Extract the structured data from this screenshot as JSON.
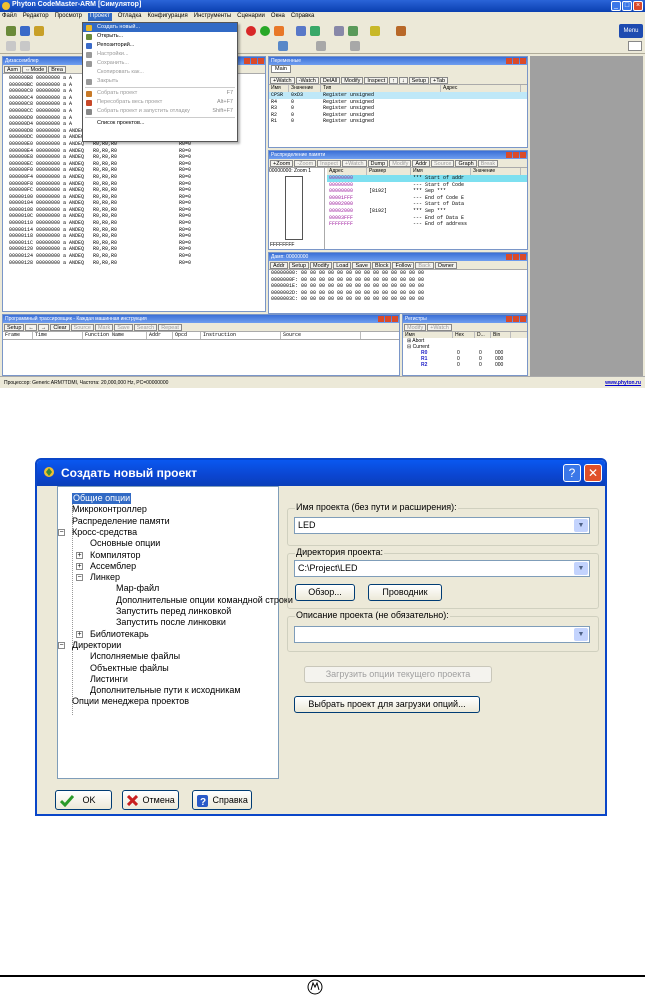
{
  "ide": {
    "title": "Phyton CodeMaster-ARM [Симулятор]",
    "menu": [
      "Файл",
      "Редактор",
      "Просмотр",
      "Проект",
      "Отладка",
      "Конфигурация",
      "Инструменты",
      "Сценарии",
      "Окна",
      "Справка"
    ],
    "menu_selected": "Проект",
    "menu_button": "Menu",
    "project_menu": [
      {
        "label": "Создать новый...",
        "shortcut": "",
        "state": "active",
        "icon_color": "#e8b828"
      },
      {
        "label": "Открыть...",
        "shortcut": "",
        "state": "normal",
        "icon_color": "#6a8a3a"
      },
      {
        "label": "Репозиторий...",
        "shortcut": "",
        "state": "normal",
        "icon_color": "#3a6ac8"
      },
      {
        "label": "Настройки...",
        "shortcut": "",
        "state": "disabled",
        "icon_color": "#999999"
      },
      {
        "label": "Сохранить...",
        "shortcut": "",
        "state": "disabled",
        "icon_color": "#999999"
      },
      {
        "label": "Скопировать как...",
        "shortcut": "",
        "state": "disabled",
        "icon_color": "#ffffff"
      },
      {
        "label": "Закрыть",
        "shortcut": "",
        "state": "disabled",
        "icon_color": "#999999"
      },
      {
        "label": "Собрать проект",
        "shortcut": "F7",
        "state": "disabled",
        "icon_color": "#c87a28"
      },
      {
        "label": "Пересобрать весь проект",
        "shortcut": "Alt+F7",
        "state": "disabled",
        "icon_color": "#c84828"
      },
      {
        "label": "Собрать проект и запустить отладку",
        "shortcut": "Shift+F7",
        "state": "disabled",
        "icon_color": "#888888"
      },
      {
        "label": "Список проектов...",
        "shortcut": "",
        "state": "normal",
        "icon_color": "#ffffff"
      }
    ],
    "disasm": {
      "title": "Дизассемблер",
      "buttons": [
        "Asm",
        "⇔Mode",
        "Brea"
      ],
      "rows": [
        "000000B8 00000000 a A",
        "000000BC 00000000 a A",
        "000000C0 00000000 a A",
        "000000C4 00000000 a A",
        "000000C8 00000000 a A",
        "000000CC 00000000 a A",
        "000000D0 00000000 a A",
        "000000D4 00000000 a A",
        "000000D8 00000000 a ANDEQ   R0,R0,R0",
        "000000DC 00000000 a ANDEQ   R0,R0,R0",
        "000000E0 00000000 a ANDEQ   R0,R0,R0",
        "000000E4 00000000 a ANDEQ   R0,R0,R0",
        "000000E8 00000000 a ANDEQ   R0,R0,R0",
        "000000EC 00000000 a ANDEQ   R0,R0,R0",
        "000000F0 00000000 a ANDEQ   R0,R0,R0",
        "000000F4 00000000 a ANDEQ   R0,R0,R0",
        "000000F8 00000000 a ANDEQ   R0,R0,R0",
        "000000FC 00000000 a ANDEQ   R0,R0,R0",
        "00000100 00000000 a ANDEQ   R0,R0,R0",
        "00000104 00000000 a ANDEQ   R0,R0,R0",
        "00000108 00000000 a ANDEQ   R0,R0,R0",
        "0000010C 00000000 a ANDEQ   R0,R0,R0",
        "00000110 00000000 a ANDEQ   R0,R0,R0",
        "00000114 00000000 a ANDEQ   R0,R0,R0",
        "00000118 00000000 a ANDEQ   R0,R0,R0",
        "0000011C 00000000 a ANDEQ   R0,R0,R0",
        "00000120 00000000 a ANDEQ   R0,R0,R0",
        "00000124 00000000 a ANDEQ   R0,R0,R0",
        "00000128 00000000 a ANDEQ   R0,R0,R0"
      ],
      "comment": "R0=0"
    },
    "vars": {
      "title": "Переменные",
      "tab": "Main",
      "buttons": [
        "+Watch",
        "-Watch",
        "DelAll",
        "Modify",
        "Inspect",
        "↑",
        "↓",
        "Setup",
        "+Tab"
      ],
      "headers": [
        "Имя",
        "Значение",
        "Тип",
        "Адрес"
      ],
      "rows": [
        [
          "CPSR",
          "0xD3",
          "Register unsigned"
        ],
        [
          "R4",
          "0",
          "Register unsigned"
        ],
        [
          "R3",
          "0",
          "Register unsigned"
        ],
        [
          "R2",
          "0",
          "Register unsigned"
        ],
        [
          "R1",
          "0",
          "Register unsigned"
        ]
      ]
    },
    "memmap": {
      "title": "Распределение памяти",
      "buttons": [
        "+Zoom",
        "-Zoom",
        "Inspect",
        "+Watch",
        "Dump",
        "Modify",
        "Addr",
        "Source",
        "Graph",
        "Break"
      ],
      "zoom_label": "00000000: Zoom 1",
      "end_addr": "FFFFFFFF",
      "headers": [
        "Адрес",
        "Размер",
        "Имя",
        "Значение"
      ],
      "rows": [
        [
          "00000000",
          "",
          "*** Start of addr"
        ],
        [
          "00000000",
          "",
          "--- Start of Code"
        ],
        [
          "00000000",
          "[8192]",
          "*** Sep ***"
        ],
        [
          "00001FFF",
          "",
          "--- End of Code E"
        ],
        [
          "00002000",
          "",
          "--- Start of Data"
        ],
        [
          "00002000",
          "[8192]",
          "*** Sep ***"
        ],
        [
          "00003FFF",
          "",
          "--- End of Data E"
        ],
        [
          "FFFFFFFF",
          "",
          "--- End of address"
        ]
      ]
    },
    "dump": {
      "title": "Дамп: 00000000",
      "buttons": [
        "Addr",
        "Setup",
        "Modify",
        "Load",
        "Save",
        "Block",
        "Follow",
        "Back",
        "Owner"
      ],
      "rows": [
        "00000000: 00 00 00 00 00 00 00 00 00 00 00 00 00 00",
        "0000000F: 00 00 00 00 00 00 00 00 00 00 00 00 00 00",
        "0000001E: 00 00 00 00 00 00 00 00 00 00 00 00 00 00",
        "0000002D: 00 00 00 00 00 00 00 00 00 00 00 00 00 00",
        "0000003C: 00 00 00 00 00 00 00 00 00 00 00 00 00 00"
      ]
    },
    "trace": {
      "title": "Программный трассировщик - Каждая машинная инструкция",
      "buttons": [
        "Setup",
        "←",
        "→",
        "Clear",
        "Source",
        "Mark",
        "Save",
        "Search",
        "Repeat"
      ],
      "headers": [
        "Frame",
        "Time",
        "Function Name",
        "Addr",
        "Opcd",
        "Instruction",
        "Source"
      ]
    },
    "regs": {
      "title": "Регистры",
      "buttons": [
        "Modify",
        "+Watch"
      ],
      "headers": [
        "Имя",
        "Hex",
        "D...",
        "Bin"
      ],
      "rows": [
        [
          "⊞ Abort",
          "",
          "",
          ""
        ],
        [
          "⊟ Current",
          "",
          "",
          ""
        ],
        [
          "R0",
          "0",
          "0",
          "000"
        ],
        [
          "R1",
          "0",
          "0",
          "000"
        ],
        [
          "R2",
          "0",
          "0",
          "000"
        ]
      ]
    },
    "status": "Процессор: Generic ARM7TDMI,  Частота: 20,000,000 Hz,  PC=00000000",
    "status_link": "www.phyton.ru"
  },
  "dialog": {
    "title": "Создать новый проект",
    "help_label": "?",
    "close_label": "✕",
    "tree": [
      {
        "label": "Общие опции",
        "level": 0,
        "selected": true,
        "expander": ""
      },
      {
        "label": "Микроконтроллер",
        "level": 0,
        "selected": false,
        "expander": ""
      },
      {
        "label": "Распределение памяти",
        "level": 0,
        "selected": false,
        "expander": ""
      },
      {
        "label": "Кросс-средства",
        "level": 0,
        "selected": false,
        "expander": "−"
      },
      {
        "label": "Основные опции",
        "level": 1,
        "selected": false,
        "expander": ""
      },
      {
        "label": "Компилятор",
        "level": 1,
        "selected": false,
        "expander": "+"
      },
      {
        "label": "Ассемблер",
        "level": 1,
        "selected": false,
        "expander": "+"
      },
      {
        "label": "Линкер",
        "level": 1,
        "selected": false,
        "expander": "−"
      },
      {
        "label": "Мар-файл",
        "level": 2,
        "selected": false,
        "expander": ""
      },
      {
        "label": "Дополнительные опции командной строки",
        "level": 2,
        "selected": false,
        "expander": ""
      },
      {
        "label": "Запустить перед линковкой",
        "level": 2,
        "selected": false,
        "expander": ""
      },
      {
        "label": "Запустить после линковки",
        "level": 2,
        "selected": false,
        "expander": ""
      },
      {
        "label": "Библиотекарь",
        "level": 1,
        "selected": false,
        "expander": "+"
      },
      {
        "label": "Директории",
        "level": 0,
        "selected": false,
        "expander": "−"
      },
      {
        "label": "Исполняемые файлы",
        "level": 1,
        "selected": false,
        "expander": ""
      },
      {
        "label": "Объектные файлы",
        "level": 1,
        "selected": false,
        "expander": ""
      },
      {
        "label": "Листинги",
        "level": 1,
        "selected": false,
        "expander": ""
      },
      {
        "label": "Дополнительные пути к исходникам",
        "level": 1,
        "selected": false,
        "expander": ""
      },
      {
        "label": "Опции менеджера проектов",
        "level": 0,
        "selected": false,
        "expander": ""
      }
    ],
    "project_name_label": "Имя проекта (без пути и расширения):",
    "project_name_value": "LED",
    "project_dir_label": "Директория проекта:",
    "project_dir_value": "C:\\Project\\LED",
    "browse_button": "Обзор...",
    "explorer_button": "Проводник",
    "description_label": "Описание проекта (не обязательно):",
    "description_value": "",
    "load_current_button": "Загрузить опции текущего проекта",
    "choose_project_button": "Выбрать проект для загрузки  опций...",
    "ok_button": "OK",
    "cancel_button": "Отмена",
    "help_button": "Справка"
  }
}
